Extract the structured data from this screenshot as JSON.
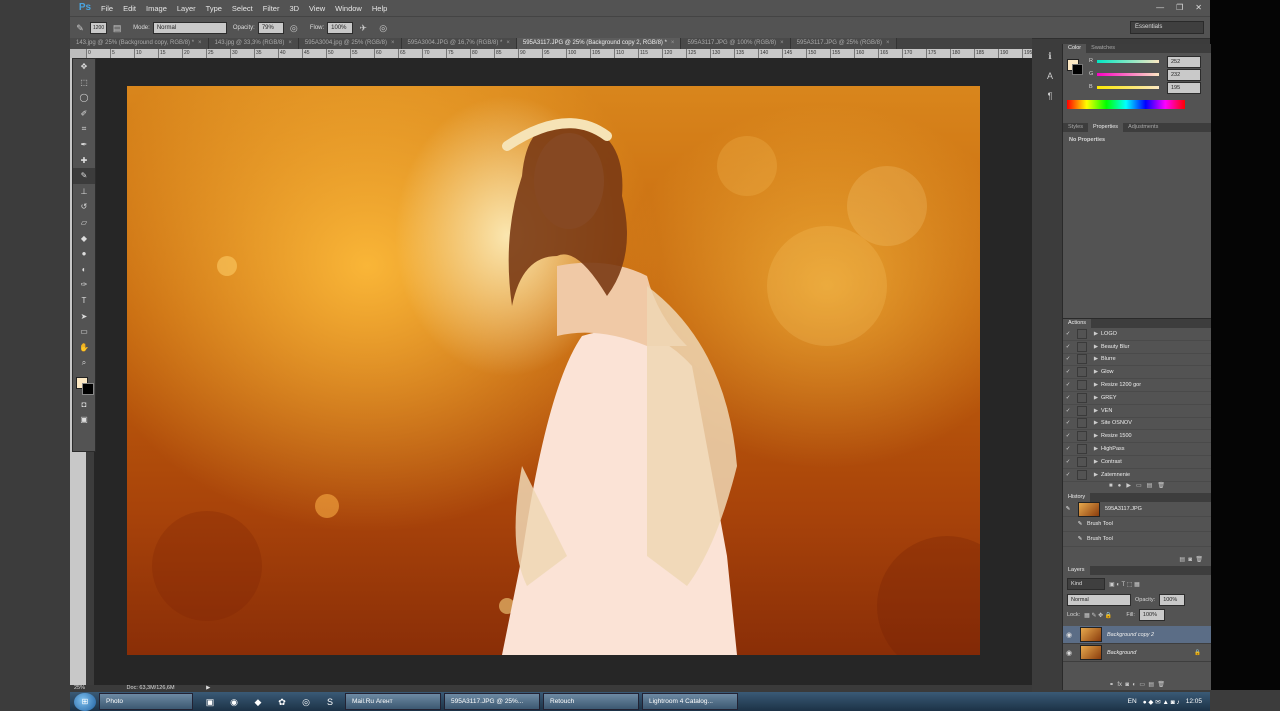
{
  "app": {
    "logo": "Ps"
  },
  "menu": [
    "File",
    "Edit",
    "Image",
    "Layer",
    "Type",
    "Select",
    "Filter",
    "3D",
    "View",
    "Window",
    "Help"
  ],
  "window_controls": [
    "—",
    "❐",
    "✕"
  ],
  "options": {
    "brush_size": "1200",
    "mode_label": "Mode:",
    "mode_value": "Normal",
    "opacity_label": "Opacity:",
    "opacity_value": "79%",
    "flow_label": "Flow:",
    "flow_value": "100%",
    "workspace": "Essentials"
  },
  "tabs": [
    {
      "label": "143.jpg @ 25% (Background copy, RGB/8) *",
      "active": false
    },
    {
      "label": "143.jpg @ 33,3% (RGB/8)",
      "active": false
    },
    {
      "label": "595A3004.jpg @ 25% (RGB/8)",
      "active": false
    },
    {
      "label": "595A3004.JPG @ 16,7% (RGB/8) *",
      "active": false
    },
    {
      "label": "595A3117.JPG @ 25% (Background copy 2, RGB/8) *",
      "active": true
    },
    {
      "label": "595A3117.JPG @ 100% (RGB/8)",
      "active": false
    },
    {
      "label": "595A3117.JPG @ 25% (RGB/8)",
      "active": false
    }
  ],
  "ruler_numbers": [
    "0",
    "5",
    "10",
    "15",
    "20",
    "25",
    "30",
    "35",
    "40",
    "45",
    "50",
    "55",
    "60",
    "65",
    "70",
    "75",
    "80",
    "85",
    "90",
    "95",
    "100",
    "105",
    "110",
    "115",
    "120",
    "125",
    "130",
    "135",
    "140",
    "145",
    "150",
    "155",
    "160",
    "165",
    "170",
    "175",
    "180",
    "185",
    "190",
    "195",
    "200",
    "205",
    "210"
  ],
  "tools": [
    "move-icon",
    "marquee-icon",
    "lasso-icon",
    "quick-select-icon",
    "crop-icon",
    "eyedropper-icon",
    "healing-icon",
    "brush-icon",
    "stamp-icon",
    "history-brush-icon",
    "eraser-icon",
    "gradient-icon",
    "blur-icon",
    "dodge-icon",
    "pen-icon",
    "type-icon",
    "path-select-icon",
    "shape-icon",
    "hand-icon",
    "zoom-icon"
  ],
  "status": {
    "zoom": "25%",
    "doc": "Doc: 63,3M/126,6M"
  },
  "color_panel": {
    "tabs": [
      "Color",
      "Swatches"
    ],
    "r": "252",
    "g": "232",
    "b": "195",
    "fg_color": "#fce8c3"
  },
  "properties_panel": {
    "tabs": [
      "Styles",
      "Properties",
      "Adjustments"
    ],
    "content": "No Properties"
  },
  "actions_panel": {
    "title": "Actions",
    "items": [
      {
        "label": "LOGO",
        "selected": false
      },
      {
        "label": "Beauty Blur",
        "selected": false
      },
      {
        "label": "Blurre",
        "selected": false
      },
      {
        "label": "Glow",
        "selected": false
      },
      {
        "label": "Resize 1200 gor",
        "selected": false
      },
      {
        "label": "GREY",
        "selected": false
      },
      {
        "label": "VEN",
        "selected": false
      },
      {
        "label": "Site OSNOV",
        "selected": false
      },
      {
        "label": "Resize 1500",
        "selected": false
      },
      {
        "label": "HighPass",
        "selected": false
      },
      {
        "label": "Contrast",
        "selected": false
      },
      {
        "label": "Zatemnenie",
        "selected": false
      },
      {
        "label": "highpass",
        "selected": true
      }
    ]
  },
  "history_panel": {
    "title": "History",
    "snapshot": "595A3117.JPG",
    "items": [
      "Brush Tool",
      "Brush Tool"
    ]
  },
  "layers_panel": {
    "title": "Layers",
    "kind": "Kind",
    "blend_mode": "Normal",
    "opacity_label": "Opacity:",
    "opacity_value": "100%",
    "lock_label": "Lock:",
    "fill_label": "Fill:",
    "fill_value": "100%",
    "layers": [
      {
        "name": "Background copy 2",
        "selected": true
      },
      {
        "name": "Background",
        "selected": false
      }
    ]
  },
  "taskbar": {
    "tasks": [
      "Photo",
      "Mail.Ru Агент",
      "595A3117.JPG @ 25%...",
      "Retouch",
      "Lightroom 4 Catalog..."
    ],
    "lang": "EN",
    "time": "12:05"
  }
}
